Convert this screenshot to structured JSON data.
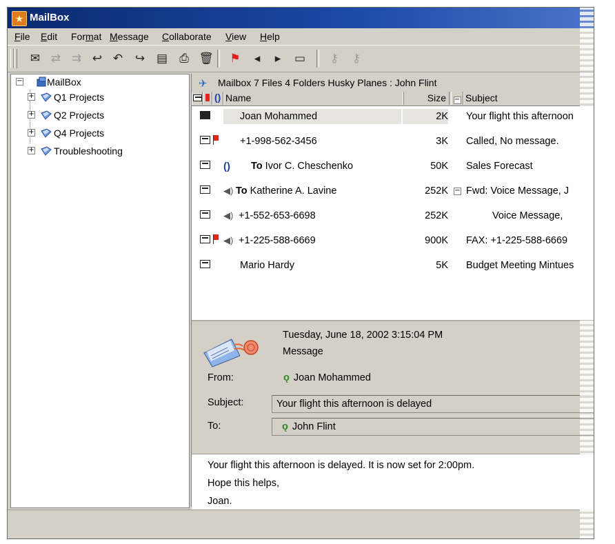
{
  "window": {
    "title": "MailBox"
  },
  "menu": [
    {
      "label": "File",
      "u": "F",
      "rest": "ile"
    },
    {
      "label": "Edit",
      "u": "E",
      "rest": "dit"
    },
    {
      "label": "Format",
      "pre": "For",
      "u": "m",
      "rest": "at"
    },
    {
      "label": "Message",
      "u": "M",
      "rest": "essage"
    },
    {
      "label": "Collaborate",
      "u": "C",
      "rest": "ollaborate"
    },
    {
      "label": "View",
      "u": "V",
      "rest": "iew"
    },
    {
      "label": "Help",
      "u": "H",
      "rest": "elp"
    }
  ],
  "toolbar": {
    "icons": [
      "new-message-icon",
      "send-receive-icon",
      "forward-to-folder-icon",
      "reply-icon",
      "reply-all-icon",
      "forward-icon",
      "address-book-icon",
      "print-icon",
      "delete-icon",
      "flag-icon",
      "previous-icon",
      "next-icon",
      "move-to-folder-icon",
      "key-icon",
      "key-alt-icon"
    ]
  },
  "tree": {
    "root": "MailBox",
    "folders": [
      "Q1 Projects",
      "Q2 Projects",
      "Q4 Projects",
      "Troubleshooting"
    ]
  },
  "mailbox_header": {
    "text": "Mailbox  7 Files  4 Folders   Husky Planes : John Flint"
  },
  "columns": {
    "name": "Name",
    "size": "Size",
    "subject": "Subject"
  },
  "messages": [
    {
      "name": "Joan Mohammed",
      "size": "2K",
      "subject": "Your flight this afternoon",
      "to": "",
      "flag": false,
      "clip": false,
      "voice": false,
      "selected": true,
      "sealed": true,
      "expander": false,
      "indent": false
    },
    {
      "name": "+1-998-562-3456",
      "size": "3K",
      "subject": "Called, No message.",
      "to": "",
      "flag": true,
      "clip": false,
      "voice": false,
      "selected": false,
      "sealed": false,
      "expander": false,
      "indent": false
    },
    {
      "name": "Ivor C. Cheschenko",
      "size": "50K",
      "subject": "Sales Forecast",
      "to": "To",
      "flag": false,
      "clip": true,
      "voice": false,
      "selected": false,
      "sealed": false,
      "expander": false,
      "indent": false
    },
    {
      "name": "Katherine A. Lavine",
      "size": "252K",
      "subject": "Fwd: Voice Message, J",
      "to": "To",
      "flag": false,
      "clip": false,
      "voice": true,
      "selected": false,
      "sealed": false,
      "expander": true,
      "indent": false
    },
    {
      "name": "+1-552-653-6698",
      "size": "252K",
      "subject": "Voice Message,",
      "to": "",
      "flag": false,
      "clip": false,
      "voice": true,
      "selected": false,
      "sealed": false,
      "expander": false,
      "indent": true
    },
    {
      "name": "+1-225-588-6669",
      "size": "900K",
      "subject": "FAX: +1-225-588-6669",
      "to": "",
      "flag": true,
      "clip": false,
      "voice": true,
      "selected": false,
      "sealed": false,
      "expander": false,
      "indent": false
    },
    {
      "name": "Mario Hardy",
      "size": "5K",
      "subject": "Budget Meeting Mintues",
      "to": "",
      "flag": false,
      "clip": false,
      "voice": false,
      "selected": false,
      "sealed": false,
      "expander": false,
      "indent": false
    }
  ],
  "preview": {
    "date": "Tuesday, June 18, 2002 3:15:04 PM",
    "type": "Message",
    "from_label": "From:",
    "from": "Joan Mohammed",
    "subject_label": "Subject:",
    "subject": "Your flight this afternoon is delayed",
    "to_label": "To:",
    "to": "John Flint"
  },
  "body": {
    "lines": [
      "Your flight this afternoon is delayed.  It is now set for 2:00pm.",
      "Hope this helps,",
      "Joan."
    ]
  },
  "colors": {
    "title_bar": "#0b2a6f",
    "flag": "#e2261c",
    "person": "#2b8a1e",
    "chrome": "#d4d0c8"
  }
}
